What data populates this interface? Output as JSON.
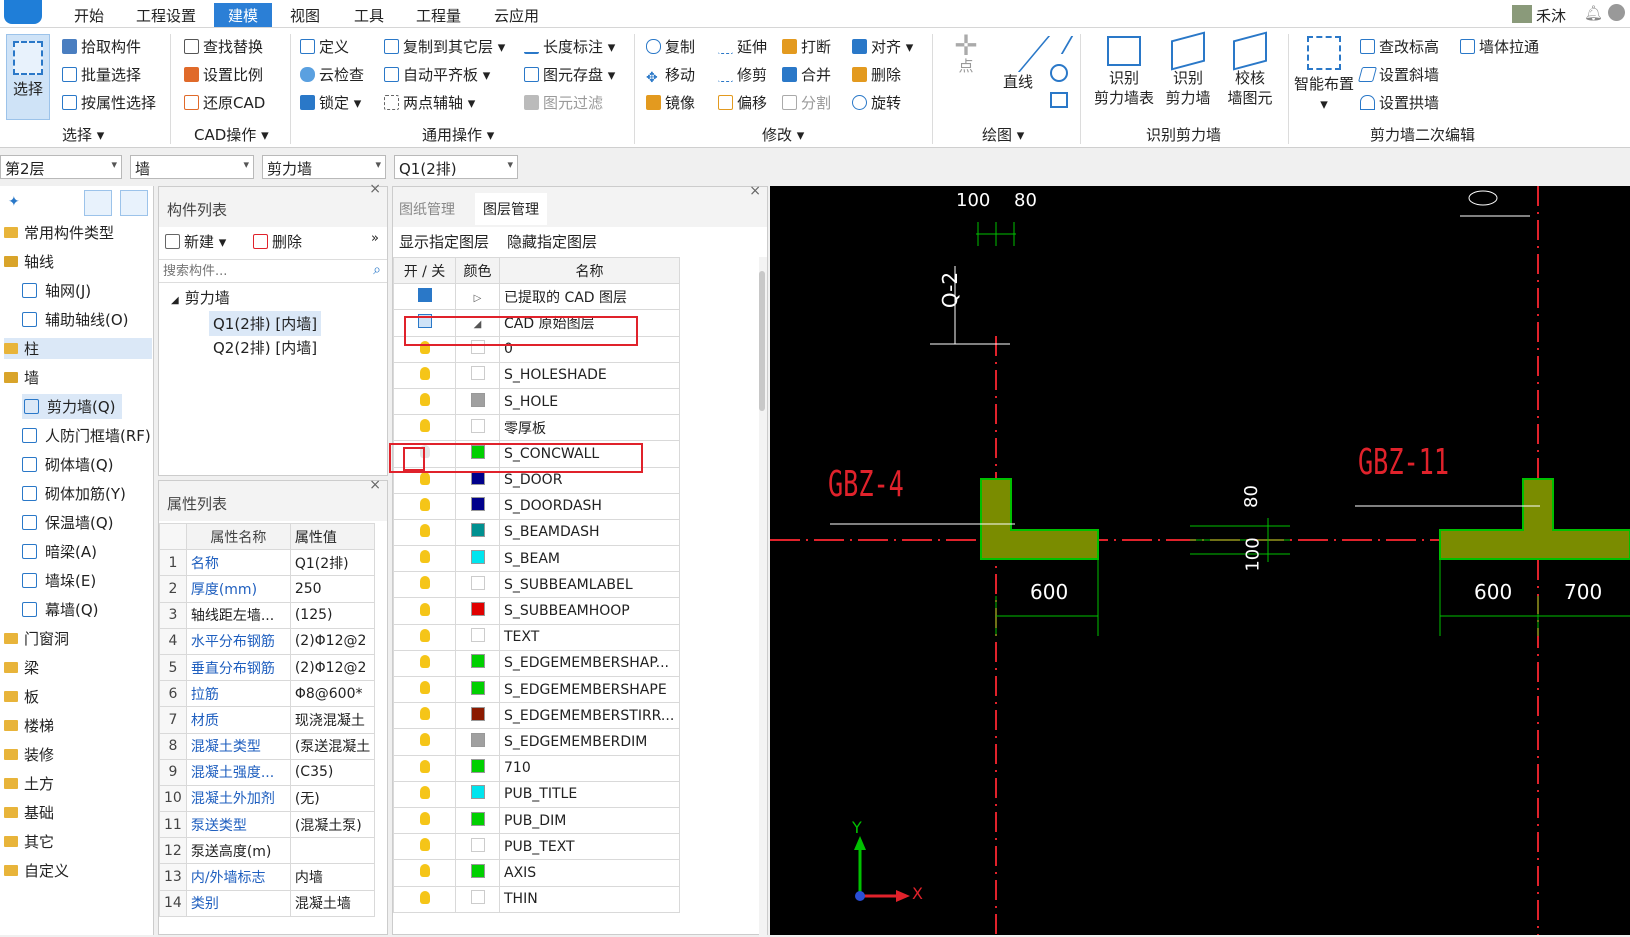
{
  "menu": {
    "items": [
      "开始",
      "工程设置",
      "建模",
      "视图",
      "工具",
      "工程量",
      "云应用"
    ],
    "active": "建模",
    "user": "禾沐"
  },
  "ribbon": {
    "select_big": "选择",
    "select_items": [
      "拾取构件",
      "批量选择",
      "按属性选择"
    ],
    "select_group": "选择",
    "cad_items": [
      "查找替换",
      "设置比例",
      "还原CAD"
    ],
    "cad_group": "CAD操作",
    "general_col1": [
      "定义",
      "云检查",
      "锁定"
    ],
    "general_col2": [
      "复制到其它层",
      "自动平齐板",
      "两点辅轴"
    ],
    "general_col3": [
      "长度标注",
      "图元存盘",
      "图元过滤"
    ],
    "general_group": "通用操作",
    "modify_col1": [
      "复制",
      "移动",
      "镜像"
    ],
    "modify_col2": [
      "延伸",
      "修剪",
      "偏移"
    ],
    "modify_col3": [
      "打断",
      "合并",
      "分割"
    ],
    "modify_col4": [
      "对齐",
      "删除",
      "旋转"
    ],
    "modify_group": "修改",
    "draw_point": "点",
    "draw_line": "直线",
    "draw_group": "绘图",
    "recog": [
      [
        "识别",
        "剪力墙表"
      ],
      [
        "识别",
        "剪力墙"
      ],
      [
        "校核",
        "墙图元"
      ]
    ],
    "recog_group": "识别剪力墙",
    "smart": "智能布置",
    "edit_items": [
      "查改标高",
      "设置斜墙",
      "设置拱墙"
    ],
    "edit_extra": "墙体拉通",
    "edit_group": "剪力墙二次编辑"
  },
  "toolbar2": {
    "floor": "第2层",
    "category": "墙",
    "type": "剪力墙",
    "component": "Q1(2排)"
  },
  "nav": {
    "items": [
      {
        "label": "常用构件类型",
        "kind": "folder"
      },
      {
        "label": "轴线",
        "kind": "folder-open"
      },
      {
        "label": "轴网(J)",
        "kind": "child"
      },
      {
        "label": "辅助轴线(O)",
        "kind": "child"
      },
      {
        "label": "柱",
        "kind": "folder"
      },
      {
        "label": "墙",
        "kind": "folder-open"
      },
      {
        "label": "剪力墙(Q)",
        "kind": "child-selected"
      },
      {
        "label": "人防门框墙(RF)",
        "kind": "child"
      },
      {
        "label": "砌体墙(Q)",
        "kind": "child"
      },
      {
        "label": "砌体加筋(Y)",
        "kind": "child"
      },
      {
        "label": "保温墙(Q)",
        "kind": "child"
      },
      {
        "label": "暗梁(A)",
        "kind": "child"
      },
      {
        "label": "墙垛(E)",
        "kind": "child"
      },
      {
        "label": "幕墙(Q)",
        "kind": "child"
      },
      {
        "label": "门窗洞",
        "kind": "folder"
      },
      {
        "label": "梁",
        "kind": "folder"
      },
      {
        "label": "板",
        "kind": "folder"
      },
      {
        "label": "楼梯",
        "kind": "folder"
      },
      {
        "label": "装修",
        "kind": "folder"
      },
      {
        "label": "土方",
        "kind": "folder"
      },
      {
        "label": "基础",
        "kind": "folder"
      },
      {
        "label": "其它",
        "kind": "folder"
      },
      {
        "label": "自定义",
        "kind": "folder"
      }
    ]
  },
  "components": {
    "title": "构件列表",
    "new": "新建",
    "delete": "删除",
    "search_placeholder": "搜索构件...",
    "tree_root": "剪力墙",
    "tree_items": [
      "Q1(2排) [内墙]",
      "Q2(2排) [内墙]"
    ]
  },
  "properties": {
    "title": "属性列表",
    "col_name": "属性名称",
    "col_value": "属性值",
    "rows": [
      {
        "n": "1",
        "k": "名称",
        "v": "Q1(2排)"
      },
      {
        "n": "2",
        "k": "厚度(mm)",
        "v": "250"
      },
      {
        "n": "3",
        "k": "轴线距左墙...",
        "v": "(125)"
      },
      {
        "n": "4",
        "k": "水平分布钢筋",
        "v": "(2)Φ12@2"
      },
      {
        "n": "5",
        "k": "垂直分布钢筋",
        "v": "(2)Φ12@2"
      },
      {
        "n": "6",
        "k": "拉筋",
        "v": "Φ8@600*"
      },
      {
        "n": "7",
        "k": "材质",
        "v": "现浇混凝土"
      },
      {
        "n": "8",
        "k": "混凝土类型",
        "v": "(泵送混凝土"
      },
      {
        "n": "9",
        "k": "混凝土强度...",
        "v": "(C35)"
      },
      {
        "n": "10",
        "k": "混凝土外加剂",
        "v": "(无)"
      },
      {
        "n": "11",
        "k": "泵送类型",
        "v": "(混凝土泵)"
      },
      {
        "n": "12",
        "k": "泵送高度(m)",
        "v": ""
      },
      {
        "n": "13",
        "k": "内/外墙标志",
        "v": "内墙"
      },
      {
        "n": "14",
        "k": "类别",
        "v": "混凝土墙"
      }
    ]
  },
  "layers": {
    "tab1": "图纸管理",
    "tab2": "图层管理",
    "show": "显示指定图层",
    "hide": "隐藏指定图层",
    "col_onoff": "开 / 关",
    "col_color": "颜色",
    "col_name": "名称",
    "rows": [
      {
        "name": "已提取的 CAD 图层",
        "color": "",
        "type": "group"
      },
      {
        "name": "CAD 原始图层",
        "color": "",
        "type": "group-open"
      },
      {
        "name": "0",
        "color": "#ffffff"
      },
      {
        "name": "S_HOLESHADE",
        "color": "#ffffff"
      },
      {
        "name": "S_HOLE",
        "color": "#a0a0a0"
      },
      {
        "name": "零厚板",
        "color": "#ffffff"
      },
      {
        "name": "S_CONCWALL",
        "color": "#00d000",
        "off": true
      },
      {
        "name": "S_DOOR",
        "color": "#00008b"
      },
      {
        "name": "S_DOORDASH",
        "color": "#00008b"
      },
      {
        "name": "S_BEAMDASH",
        "color": "#009090"
      },
      {
        "name": "S_BEAM",
        "color": "#00e5ee"
      },
      {
        "name": "S_SUBBEAMLABEL",
        "color": "#ffffff"
      },
      {
        "name": "S_SUBBEAMHOOP",
        "color": "#e00000"
      },
      {
        "name": "TEXT",
        "color": "#ffffff"
      },
      {
        "name": "S_EDGEMEMBERSHAP...",
        "color": "#00d000"
      },
      {
        "name": "S_EDGEMEMBERSHAPE",
        "color": "#00d000"
      },
      {
        "name": "S_EDGEMEMBERSTIRR...",
        "color": "#8b1a00"
      },
      {
        "name": "S_EDGEMEMBERDIM",
        "color": "#a0a0a0"
      },
      {
        "name": "710",
        "color": "#00d000"
      },
      {
        "name": "PUB_TITLE",
        "color": "#00e5ee"
      },
      {
        "name": "PUB_DIM",
        "color": "#00d000"
      },
      {
        "name": "PUB_TEXT",
        "color": "#ffffff"
      },
      {
        "name": "AXIS",
        "color": "#00d000"
      },
      {
        "name": "THIN",
        "color": "#ffffff"
      }
    ]
  },
  "cad": {
    "dim_100": "100",
    "dim_80": "80",
    "axis_label": "Q-2",
    "gbz4": "GBZ-4",
    "gbz11": "GBZ-11",
    "dim_600a": "600",
    "dim_600b": "600",
    "dim_700": "700",
    "dim_v80": "80",
    "dim_v100": "100",
    "y_axis": "Y",
    "x_axis": "X"
  }
}
